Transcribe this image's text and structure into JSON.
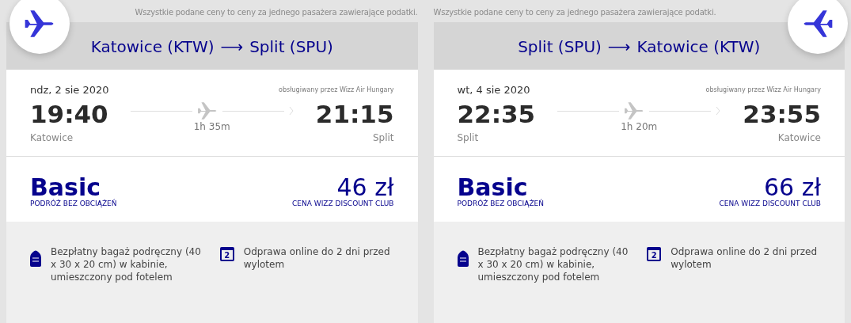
{
  "legs": [
    {
      "kind": "outbound",
      "note": "Wszystkie podane ceny to ceny za jednego pasażera zawierające podatki.",
      "origin": "Katowice (KTW)",
      "arrow": "⟶",
      "destination": "Split (SPU)",
      "date": "ndz, 2 sie 2020",
      "operator": "obsługiwany przez Wizz Air Hungary",
      "departure_time": "19:40",
      "arrival_time": "21:15",
      "departure_city": "Katowice",
      "arrival_city": "Split",
      "duration": "1h 35m",
      "fare_name": "Basic",
      "fare_subtitle": "PODRÓŻ BEZ OBCIĄŻEŃ",
      "price": "46 zł",
      "price_label": "CENA WIZZ DISCOUNT CLUB",
      "features": [
        {
          "kind": "bag",
          "text": "Bezpłatny bagaż podręczny (40 x 30 x 20 cm) w kabinie, umieszczony pod fotelem"
        },
        {
          "kind": "calendar",
          "icon_text": "2",
          "text": "Odprawa online do 2 dni przed wylotem"
        }
      ]
    },
    {
      "kind": "return",
      "note": "Wszystkie podane ceny to ceny za jednego pasażera zawierające podatki.",
      "origin": "Split (SPU)",
      "arrow": "⟶",
      "destination": "Katowice (KTW)",
      "date": "wt, 4 sie 2020",
      "operator": "obsługiwany przez Wizz Air Hungary",
      "departure_time": "22:35",
      "arrival_time": "23:55",
      "departure_city": "Split",
      "arrival_city": "Katowice",
      "duration": "1h 20m",
      "fare_name": "Basic",
      "fare_subtitle": "PODRÓŻ BEZ OBCIĄŻEŃ",
      "price": "66 zł",
      "price_label": "CENA WIZZ DISCOUNT CLUB",
      "features": [
        {
          "kind": "bag",
          "text": "Bezpłatny bagaż podręczny (40 x 30 x 20 cm) w kabinie, umieszczony pod fotelem"
        },
        {
          "kind": "calendar",
          "icon_text": "2",
          "text": "Odprawa online do 2 dni przed wylotem"
        }
      ]
    }
  ]
}
